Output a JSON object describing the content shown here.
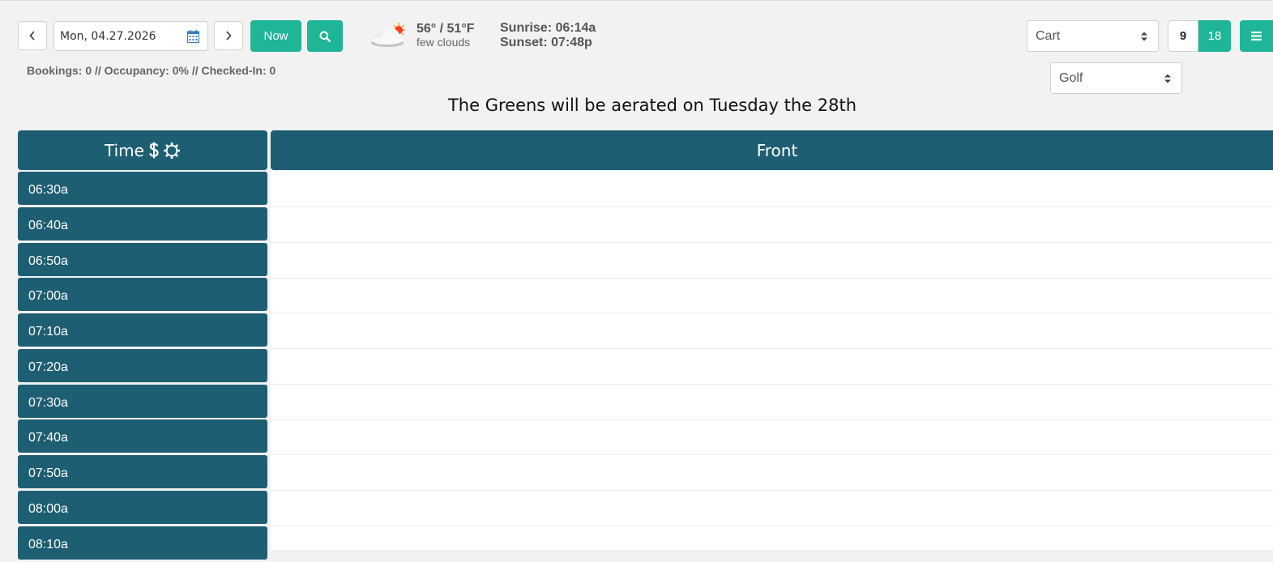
{
  "date": {
    "value": "Mon, 04.27.2026"
  },
  "buttons": {
    "now": "Now"
  },
  "weather": {
    "temp": "56° / 51°F",
    "condition": "few clouds",
    "sunrise": "Sunrise: 06:14a",
    "sunset": "Sunset: 07:48p"
  },
  "stats": "Bookings: 0 // Occupancy: 0% // Checked-In: 0",
  "selects": {
    "cart": "Cart",
    "golf": "Golf"
  },
  "holes": {
    "nine": "9",
    "eighteen": "18"
  },
  "announcement": "The Greens will be aerated on Tuesday the 28th",
  "columns": {
    "time": "Time",
    "front": "Front"
  },
  "times": [
    "06:30a",
    "06:40a",
    "06:50a",
    "07:00a",
    "07:10a",
    "07:20a",
    "07:30a",
    "07:40a",
    "07:50a",
    "08:00a",
    "08:10a"
  ],
  "icons": {
    "prev": "chevron-left-icon",
    "next": "chevron-right-icon",
    "calendar": "calendar-icon",
    "search": "search-icon",
    "weather": "partly-cloudy-icon",
    "price": "dollar-icon",
    "settings": "gear-icon",
    "menu": "hamburger-menu-icon"
  },
  "colors": {
    "accent": "#1fb597",
    "header": "#1e5e72"
  }
}
